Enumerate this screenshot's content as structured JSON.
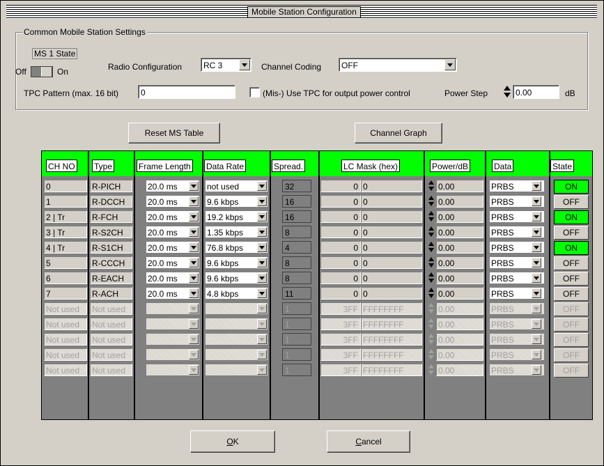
{
  "window": {
    "title": "Mobile Station Configuration"
  },
  "common": {
    "group_label": "Common Mobile Station Settings",
    "ms_state_label": "MS 1 State",
    "off_label": "Off",
    "on_label": "On",
    "radio_config_label": "Radio Configuration",
    "radio_config_value": "RC 3",
    "channel_coding_label": "Channel Coding",
    "channel_coding_value": "OFF",
    "tpc_pattern_label": "TPC Pattern (max. 16 bit)",
    "tpc_pattern_value": "0",
    "tpc_checkbox_label": "(Mis-) Use TPC for output power control",
    "power_step_label": "Power Step",
    "power_step_value": "0.00",
    "power_step_unit": "dB"
  },
  "buttons": {
    "reset": "Reset MS Table",
    "graph": "Channel Graph",
    "ok_u": "O",
    "ok_rest": "K",
    "cancel_u": "C",
    "cancel_rest": "ancel"
  },
  "table": {
    "headers": [
      "CH NO",
      "Type",
      "Frame Length",
      "Data Rate",
      "Spread.",
      "LC Mask (hex)",
      "Power/dB",
      "Data",
      "State"
    ],
    "rows": [
      {
        "ch": "0",
        "type": "R-PICH",
        "frame": "20.0 ms",
        "rate": "not used",
        "spread": "32",
        "lc1": "0",
        "lc2": "0",
        "power": "0.00",
        "data": "PRBS",
        "state": "ON"
      },
      {
        "ch": "1",
        "type": "R-DCCH",
        "frame": "20.0 ms",
        "rate": "9.6 kbps",
        "spread": "16",
        "lc1": "0",
        "lc2": "0",
        "power": "0.00",
        "data": "PRBS",
        "state": "OFF"
      },
      {
        "ch": "2 | Tr",
        "type": "R-FCH",
        "frame": "20.0 ms",
        "rate": "19.2 kbps",
        "spread": "16",
        "lc1": "0",
        "lc2": "0",
        "power": "0.00",
        "data": "PRBS",
        "state": "ON"
      },
      {
        "ch": "3 | Tr",
        "type": "R-S2CH",
        "frame": "20.0 ms",
        "rate": "1.35 kbps",
        "spread": "8",
        "lc1": "0",
        "lc2": "0",
        "power": "0.00",
        "data": "PRBS",
        "state": "OFF"
      },
      {
        "ch": "4 | Tr",
        "type": "R-S1CH",
        "frame": "20.0 ms",
        "rate": "76.8 kbps",
        "spread": "4",
        "lc1": "0",
        "lc2": "0",
        "power": "0.00",
        "data": "PRBS",
        "state": "ON"
      },
      {
        "ch": "5",
        "type": "R-CCCH",
        "frame": "20.0 ms",
        "rate": "9.6 kbps",
        "spread": "8",
        "lc1": "0",
        "lc2": "0",
        "power": "0.00",
        "data": "PRBS",
        "state": "OFF"
      },
      {
        "ch": "6",
        "type": "R-EACH",
        "frame": "20.0 ms",
        "rate": "9.6 kbps",
        "spread": "8",
        "lc1": "0",
        "lc2": "0",
        "power": "0.00",
        "data": "PRBS",
        "state": "OFF"
      },
      {
        "ch": "7",
        "type": "R-ACH",
        "frame": "20.0 ms",
        "rate": "4.8 kbps",
        "spread": "11",
        "lc1": "0",
        "lc2": "0",
        "power": "0.00",
        "data": "PRBS",
        "state": "OFF"
      },
      {
        "ch": "Not used",
        "type": "Not used",
        "frame": "",
        "rate": "",
        "spread": "1",
        "lc1": "3FF",
        "lc2": "FFFFFFFF",
        "power": "0.00",
        "data": "PRBS",
        "state": "OFF"
      },
      {
        "ch": "Not used",
        "type": "Not used",
        "frame": "",
        "rate": "",
        "spread": "1",
        "lc1": "3FF",
        "lc2": "FFFFFFFF",
        "power": "0.00",
        "data": "PRBS",
        "state": "OFF"
      },
      {
        "ch": "Not used",
        "type": "Not used",
        "frame": "",
        "rate": "",
        "spread": "1",
        "lc1": "3FF",
        "lc2": "FFFFFFFF",
        "power": "0.00",
        "data": "PRBS",
        "state": "OFF"
      },
      {
        "ch": "Not used",
        "type": "Not used",
        "frame": "",
        "rate": "",
        "spread": "1",
        "lc1": "3FF",
        "lc2": "FFFFFFFF",
        "power": "0.00",
        "data": "PRBS",
        "state": "OFF"
      },
      {
        "ch": "Not used",
        "type": "Not used",
        "frame": "",
        "rate": "",
        "spread": "1",
        "lc1": "3FF",
        "lc2": "FFFFFFFF",
        "power": "0.00",
        "data": "PRBS",
        "state": "OFF"
      }
    ],
    "disabled_from_row": 8
  },
  "colors": {
    "header_bg": "#00ff00",
    "state_on": "#00ff00",
    "dialog_bg": "#d4d0c8"
  }
}
